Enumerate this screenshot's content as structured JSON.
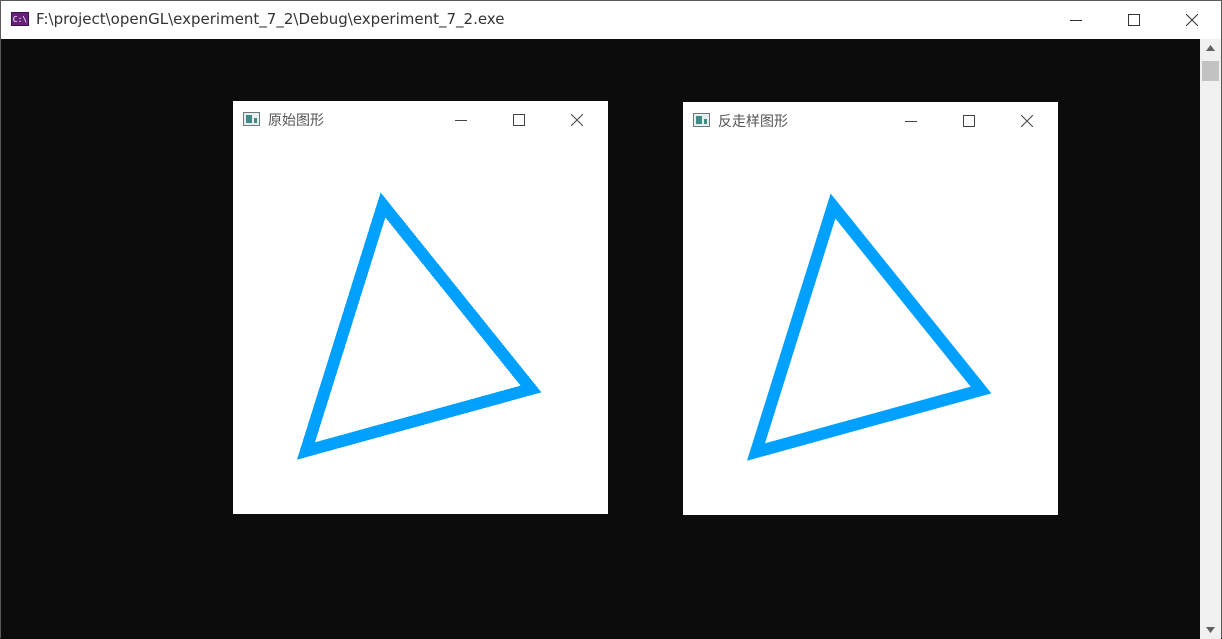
{
  "console": {
    "title": "F:\\project\\openGL\\experiment_7_2\\Debug\\experiment_7_2.exe",
    "icon_label": "C:\\",
    "icon": "console-app-icon"
  },
  "windows": [
    {
      "title": "原始图形",
      "icon": "glut-window-icon",
      "antialiased": false
    },
    {
      "title": "反走样图形",
      "icon": "glut-window-icon",
      "antialiased": true
    }
  ],
  "colors": {
    "console_background": "#0c0c0c",
    "triangle_stroke": "#00a0ff",
    "window_background": "#ffffff"
  }
}
